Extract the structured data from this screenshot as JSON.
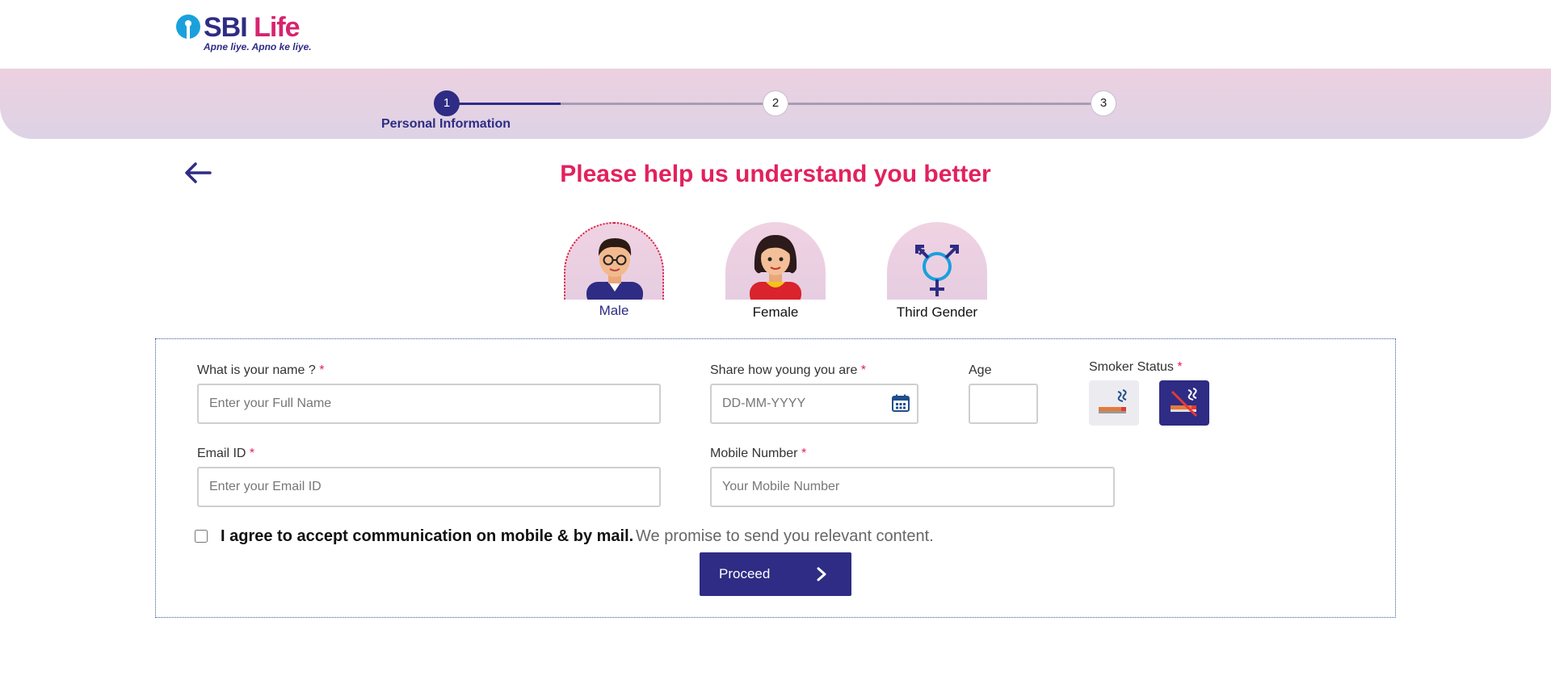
{
  "brand": {
    "name_part1": "SBI",
    "name_part2": "Life",
    "tagline": "Apne liye. Apno ke liye.",
    "colors": {
      "primary": "#2e2c84",
      "accent": "#e2215e",
      "logo_emblem": "#1aa1dc"
    }
  },
  "stepper": {
    "steps": [
      "1",
      "2",
      "3"
    ],
    "active_step": 1,
    "active_label": "Personal Information"
  },
  "page": {
    "back_icon": "arrow-left-icon",
    "heading": "Please help us understand you better"
  },
  "gender": {
    "options": [
      {
        "label": "Male",
        "icon": "male-avatar-icon",
        "selected": true
      },
      {
        "label": "Female",
        "icon": "female-avatar-icon",
        "selected": false
      },
      {
        "label": "Third Gender",
        "icon": "transgender-symbol-icon",
        "selected": false
      }
    ]
  },
  "form": {
    "name": {
      "label": "What is your name ?",
      "required": "*",
      "placeholder": "Enter your Full Name",
      "value": ""
    },
    "dob": {
      "label": "Share how young you are",
      "required": "*",
      "placeholder": "DD-MM-YYYY",
      "value": "",
      "icon": "calendar-icon"
    },
    "age": {
      "label": "Age",
      "value": ""
    },
    "smoker": {
      "label": "Smoker Status",
      "required": "*",
      "yes_icon": "smoking-icon",
      "no_icon": "no-smoking-icon",
      "selected": "no"
    },
    "email": {
      "label": "Email ID",
      "required": "*",
      "placeholder": "Enter your Email ID",
      "value": ""
    },
    "mobile": {
      "label": "Mobile Number",
      "required": "*",
      "placeholder": "Your Mobile Number",
      "value": ""
    },
    "consent": {
      "bold_text": "I agree to accept communication on mobile & by mail.",
      "soft_text": "We promise to send you relevant content.",
      "checked": false
    },
    "proceed_label": "Proceed"
  }
}
